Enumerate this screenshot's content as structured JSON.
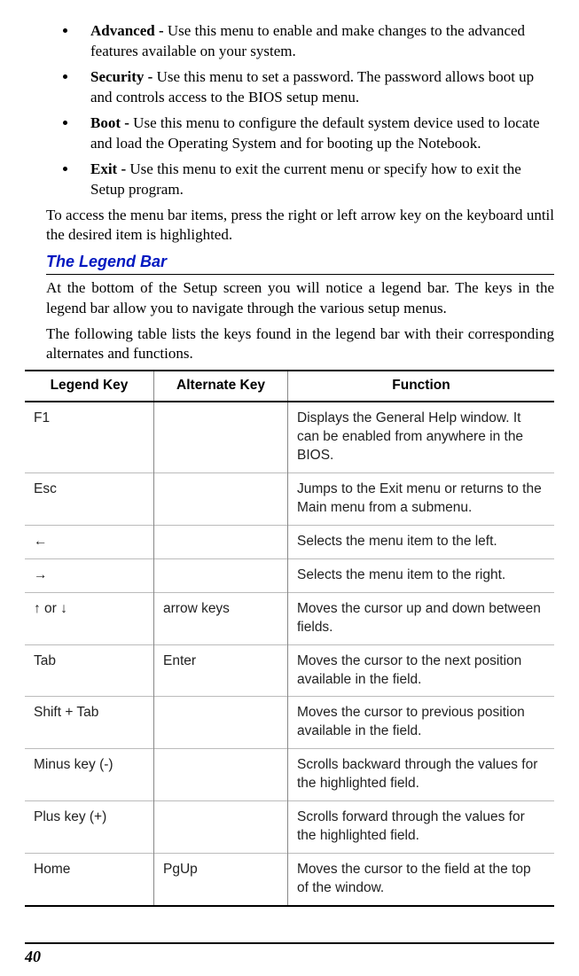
{
  "menu_items": [
    {
      "term": "Advanced - ",
      "desc": "Use this menu to enable and make changes to the advanced features available on your system."
    },
    {
      "term": "Security - ",
      "desc": "Use this menu to set a password.  The password allows boot up and controls access to the BIOS setup menu."
    },
    {
      "term": "Boot - ",
      "desc": "Use this menu to configure the default system device used to locate and load the Operating System and for booting up the Notebook."
    },
    {
      "term": "Exit - ",
      "desc": "Use this menu to exit the current menu or specify how to exit the Setup program."
    }
  ],
  "access_para": "To access the menu bar items, press the right or left arrow key on the keyboard until the desired item is highlighted.",
  "section_header": "The Legend Bar",
  "legend_intro1": "At the bottom of the Setup screen you will notice a legend bar.  The keys in the legend bar allow you to navigate through the various setup menus.",
  "legend_intro2": "The following table lists the keys found in the legend bar with their corresponding alternates and functions.",
  "table": {
    "headers": {
      "legend": "Legend Key",
      "alt": "Alternate Key",
      "func": "Function"
    },
    "rows": [
      {
        "legend": "F1",
        "alt": "",
        "func": "Displays the General Help window.  It can be enabled from anywhere in the BIOS."
      },
      {
        "legend": "Esc",
        "alt": "",
        "func": "Jumps to the Exit menu or returns to the Main menu from a submenu."
      },
      {
        "legend": "←",
        "alt": "",
        "func": "Selects the menu item to the left."
      },
      {
        "legend": "→",
        "alt": "",
        "func": "Selects the menu item to the right."
      },
      {
        "legend": "↑ or ↓",
        "alt": "arrow keys",
        "func": "Moves the cursor up and down between fields."
      },
      {
        "legend": "Tab",
        "alt": "Enter",
        "func": "Moves the cursor to the next position available in the field."
      },
      {
        "legend": "Shift + Tab",
        "alt": "",
        "func": "Moves the cursor to previous position available in the field."
      },
      {
        "legend": "Minus key (-)",
        "alt": "",
        "func": "Scrolls backward through the values for the highlighted field."
      },
      {
        "legend": "Plus key (+)",
        "alt": "",
        "func": "Scrolls forward through the values for the highlighted field."
      },
      {
        "legend": "Home",
        "alt": "PgUp",
        "func": "Moves the cursor to the field at the top of the window."
      }
    ]
  },
  "page_number": "40"
}
